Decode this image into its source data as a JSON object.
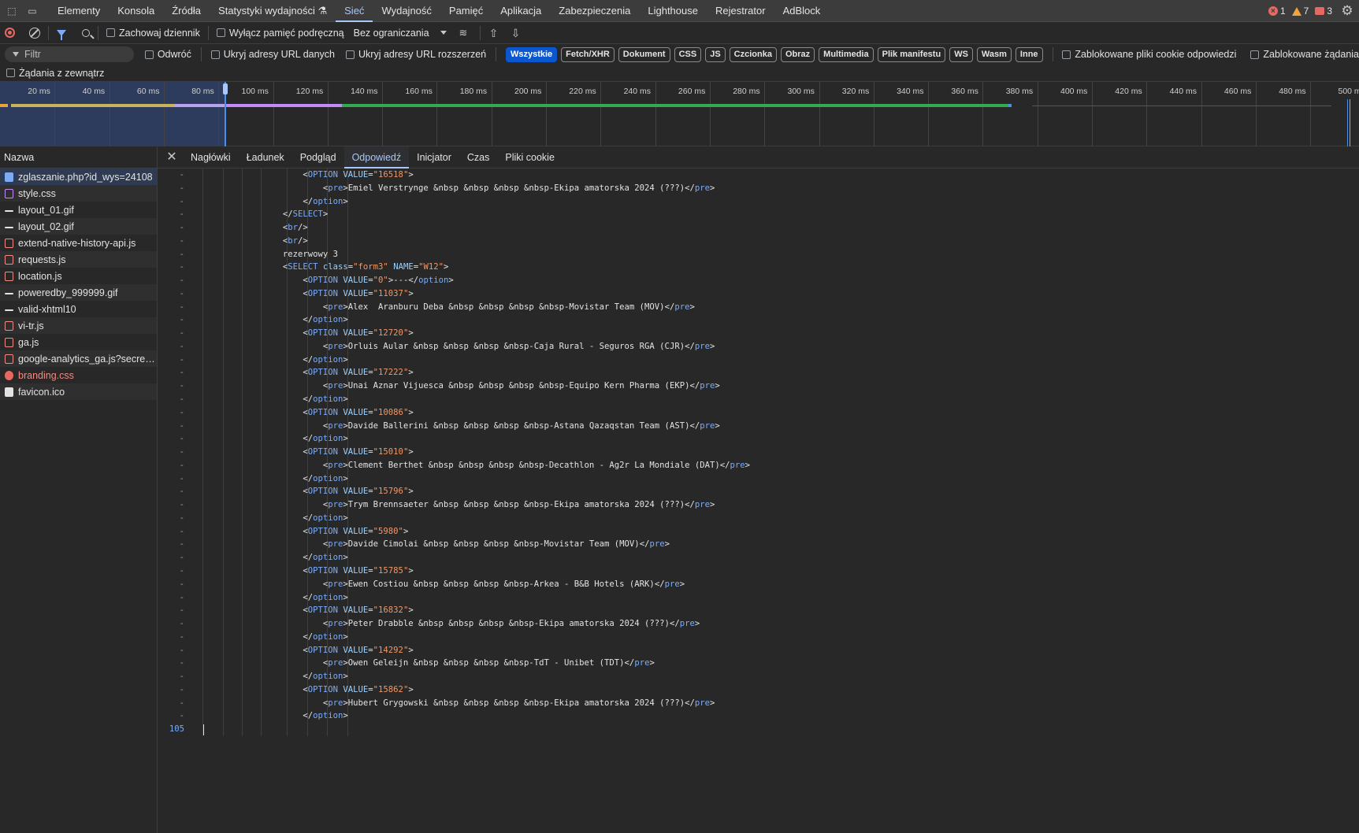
{
  "main_tabs": [
    {
      "label": "Elementy",
      "active": false
    },
    {
      "label": "Konsola",
      "active": false
    },
    {
      "label": "Źródła",
      "active": false
    },
    {
      "label": "Statystyki wydajności ⚗",
      "active": false
    },
    {
      "label": "Sieć",
      "active": true
    },
    {
      "label": "Wydajność",
      "active": false
    },
    {
      "label": "Pamięć",
      "active": false
    },
    {
      "label": "Aplikacja",
      "active": false
    },
    {
      "label": "Zabezpieczenia",
      "active": false
    },
    {
      "label": "Lighthouse",
      "active": false
    },
    {
      "label": "Rejestrator",
      "active": false
    },
    {
      "label": "AdBlock",
      "active": false
    }
  ],
  "counters": {
    "errors": "1",
    "warnings": "7",
    "issues": "3"
  },
  "toolbar": {
    "preserve_log": "Zachowaj dziennik",
    "disable_cache": "Wyłącz pamięć podręczną",
    "throttling": "Bez ograniczania"
  },
  "filterbar": {
    "filter_placeholder": "Filtr",
    "invert": "Odwróć",
    "hide_data_urls": "Ukryj adresy URL danych",
    "hide_ext_urls": "Ukryj adresy URL rozszerzeń",
    "chips": [
      "Wszystkie",
      "Fetch/XHR",
      "Dokument",
      "CSS",
      "JS",
      "Czcionka",
      "Obraz",
      "Multimedia",
      "Plik manifestu",
      "WS",
      "Wasm",
      "Inne"
    ],
    "blocked_cookies": "Zablokowane pliki cookie odpowiedzi",
    "blocked_requests": "Zablokowane żądania",
    "third_party": "Żądania z zewnątrz"
  },
  "timeline": {
    "ticks": [
      "20 ms",
      "40 ms",
      "60 ms",
      "80 ms",
      "100 ms",
      "120 ms",
      "140 ms",
      "160 ms",
      "180 ms",
      "200 ms",
      "220 ms",
      "240 ms",
      "260 ms",
      "280 ms",
      "300 ms",
      "320 ms",
      "340 ms",
      "360 ms",
      "380 ms",
      "400 ms",
      "420 ms",
      "440 ms",
      "460 ms",
      "480 ms",
      "500 m"
    ]
  },
  "requests": {
    "header": "Nazwa",
    "items": [
      {
        "name": "zglaszanie.php?id_wys=24108",
        "type": "doc",
        "selected": true
      },
      {
        "name": "style.css",
        "type": "css"
      },
      {
        "name": "layout_01.gif",
        "type": "img"
      },
      {
        "name": "layout_02.gif",
        "type": "img"
      },
      {
        "name": "extend-native-history-api.js",
        "type": "js"
      },
      {
        "name": "requests.js",
        "type": "js"
      },
      {
        "name": "location.js",
        "type": "js"
      },
      {
        "name": "poweredby_999999.gif",
        "type": "img"
      },
      {
        "name": "valid-xhtml10",
        "type": "img"
      },
      {
        "name": "vi-tr.js",
        "type": "js"
      },
      {
        "name": "ga.js",
        "type": "js"
      },
      {
        "name": "google-analytics_ga.js?secret=...",
        "type": "js"
      },
      {
        "name": "branding.css",
        "type": "err"
      },
      {
        "name": "favicon.ico",
        "type": "ico"
      }
    ]
  },
  "detail_tabs": [
    {
      "label": "Nagłówki",
      "active": false
    },
    {
      "label": "Ładunek",
      "active": false
    },
    {
      "label": "Podgląd",
      "active": false
    },
    {
      "label": "Odpowiedź",
      "active": true
    },
    {
      "label": "Inicjator",
      "active": false
    },
    {
      "label": "Czas",
      "active": false
    },
    {
      "label": "Pliki cookie",
      "active": false
    }
  ],
  "response": {
    "last_line_number": "105",
    "lines": [
      {
        "indent": 4,
        "kind": "opt",
        "value": "16518"
      },
      {
        "indent": 6,
        "kind": "pre",
        "text": "Emiel Verstrynge &nbsp &nbsp &nbsp &nbsp-Ekipa amatorska 2024 (???)"
      },
      {
        "indent": 4,
        "kind": "close",
        "tag": "option"
      },
      {
        "indent": 2,
        "kind": "close",
        "tag": "SELECT"
      },
      {
        "indent": 2,
        "kind": "br"
      },
      {
        "indent": 2,
        "kind": "br"
      },
      {
        "indent": 2,
        "kind": "text",
        "text": "rezerwowy 3"
      },
      {
        "indent": 2,
        "kind": "select",
        "cls": "form3",
        "name": "W12"
      },
      {
        "indent": 4,
        "kind": "opt0",
        "value": "0",
        "text": "---"
      },
      {
        "indent": 4,
        "kind": "opt",
        "value": "11037"
      },
      {
        "indent": 6,
        "kind": "pre",
        "text": "Alex  Aranburu Deba &nbsp &nbsp &nbsp &nbsp-Movistar Team (MOV)"
      },
      {
        "indent": 4,
        "kind": "close",
        "tag": "option"
      },
      {
        "indent": 4,
        "kind": "opt",
        "value": "12720"
      },
      {
        "indent": 6,
        "kind": "pre",
        "text": "Orluis Aular &nbsp &nbsp &nbsp &nbsp-Caja Rural - Seguros RGA (CJR)"
      },
      {
        "indent": 4,
        "kind": "close",
        "tag": "option"
      },
      {
        "indent": 4,
        "kind": "opt",
        "value": "17222"
      },
      {
        "indent": 6,
        "kind": "pre",
        "text": "Unai Aznar Vijuesca &nbsp &nbsp &nbsp &nbsp-Equipo Kern Pharma (EKP)"
      },
      {
        "indent": 4,
        "kind": "close",
        "tag": "option"
      },
      {
        "indent": 4,
        "kind": "opt",
        "value": "10086"
      },
      {
        "indent": 6,
        "kind": "pre",
        "text": "Davide Ballerini &nbsp &nbsp &nbsp &nbsp-Astana Qazaqstan Team (AST)"
      },
      {
        "indent": 4,
        "kind": "close",
        "tag": "option"
      },
      {
        "indent": 4,
        "kind": "opt",
        "value": "15010"
      },
      {
        "indent": 6,
        "kind": "pre",
        "text": "Clement Berthet &nbsp &nbsp &nbsp &nbsp-Decathlon - Ag2r La Mondiale (DAT)"
      },
      {
        "indent": 4,
        "kind": "close",
        "tag": "option"
      },
      {
        "indent": 4,
        "kind": "opt",
        "value": "15796"
      },
      {
        "indent": 6,
        "kind": "pre",
        "text": "Trym Brennsaeter &nbsp &nbsp &nbsp &nbsp-Ekipa amatorska 2024 (???)"
      },
      {
        "indent": 4,
        "kind": "close",
        "tag": "option"
      },
      {
        "indent": 4,
        "kind": "opt",
        "value": "5980"
      },
      {
        "indent": 6,
        "kind": "pre",
        "text": "Davide Cimolai &nbsp &nbsp &nbsp &nbsp-Movistar Team (MOV)"
      },
      {
        "indent": 4,
        "kind": "close",
        "tag": "option"
      },
      {
        "indent": 4,
        "kind": "opt",
        "value": "15785"
      },
      {
        "indent": 6,
        "kind": "pre",
        "text": "Ewen Costiou &nbsp &nbsp &nbsp &nbsp-Arkea - B&B Hotels (ARK)"
      },
      {
        "indent": 4,
        "kind": "close",
        "tag": "option"
      },
      {
        "indent": 4,
        "kind": "opt",
        "value": "16832"
      },
      {
        "indent": 6,
        "kind": "pre",
        "text": "Peter Drabble &nbsp &nbsp &nbsp &nbsp-Ekipa amatorska 2024 (???)"
      },
      {
        "indent": 4,
        "kind": "close",
        "tag": "option"
      },
      {
        "indent": 4,
        "kind": "opt",
        "value": "14292"
      },
      {
        "indent": 6,
        "kind": "pre",
        "text": "Owen Geleijn &nbsp &nbsp &nbsp &nbsp-TdT - Unibet (TDT)"
      },
      {
        "indent": 4,
        "kind": "close",
        "tag": "option"
      },
      {
        "indent": 4,
        "kind": "opt",
        "value": "15862"
      },
      {
        "indent": 6,
        "kind": "pre",
        "text": "Hubert Grygowski &nbsp &nbsp &nbsp &nbsp-Ekipa amatorska 2024 (???)"
      },
      {
        "indent": 4,
        "kind": "close",
        "tag": "option"
      }
    ]
  }
}
